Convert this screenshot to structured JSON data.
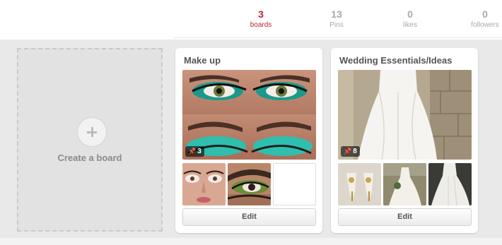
{
  "stats": [
    {
      "count": "3",
      "label": "boards",
      "active": true
    },
    {
      "count": "13",
      "label": "Pins",
      "active": false
    },
    {
      "count": "0",
      "label": "likes",
      "active": false
    },
    {
      "count": "0",
      "label": "followers",
      "active": false
    }
  ],
  "create_board": {
    "label": "Create a board"
  },
  "boards": [
    {
      "title": "Make up",
      "pin_count": "3",
      "edit_label": "Edit",
      "pin_icon": "pin-icon"
    },
    {
      "title": "Wedding Essentials/Ideas",
      "pin_count": "8",
      "edit_label": "Edit",
      "pin_icon": "pin-icon"
    }
  ],
  "colors": {
    "accent": "#c0202a",
    "muted": "#a8a8a8",
    "background": "#e9e9e9"
  }
}
